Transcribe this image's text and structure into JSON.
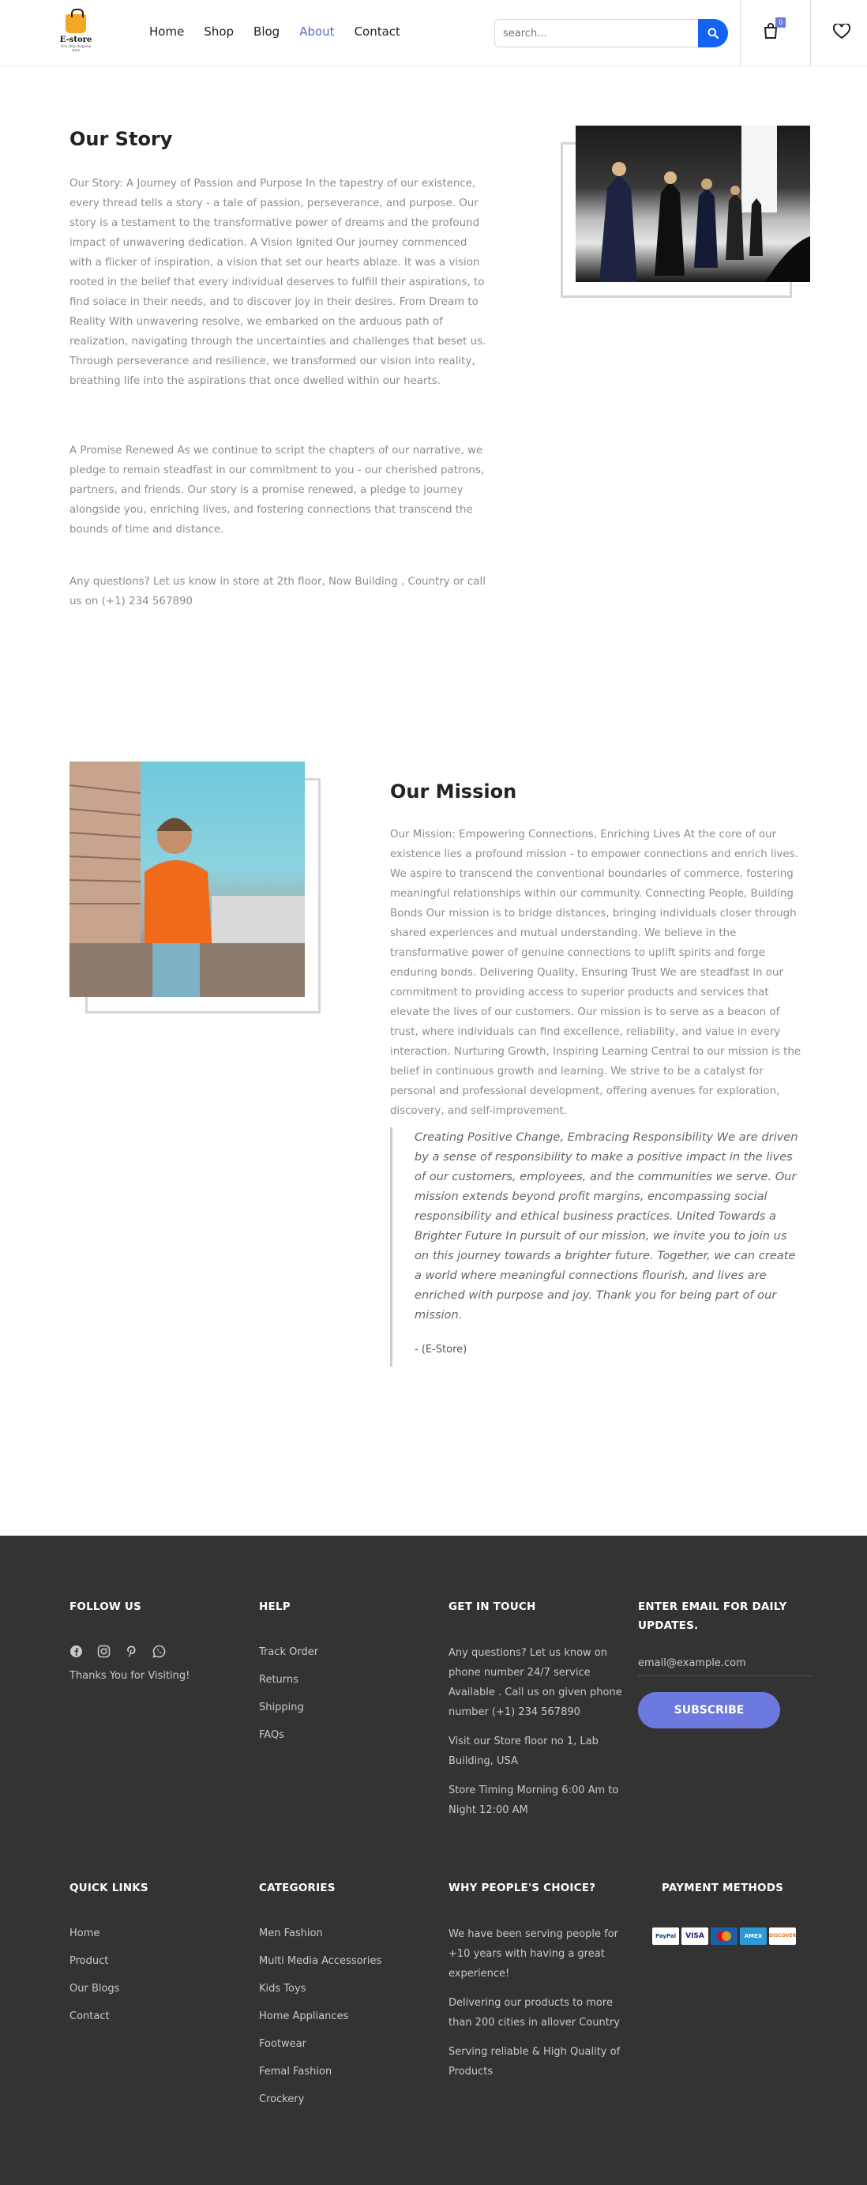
{
  "header": {
    "logo": {
      "name": "E-store",
      "tagline": "One stop shopping store"
    },
    "nav": [
      "Home",
      "Shop",
      "Blog",
      "About",
      "Contact"
    ],
    "active_nav": "About",
    "search_placeholder": "search...",
    "cart_count": "0",
    "accent": "#5c6ac4",
    "search_button_color": "#1463f3"
  },
  "story": {
    "title": "Our Story",
    "p1": "Our Story: A Journey of Passion and Purpose In the tapestry of our existence, every thread tells a story - a tale of passion, perseverance, and purpose. Our story is a testament to the transformative power of dreams and the profound impact of unwavering dedication. A Vision Ignited Our journey commenced with a flicker of inspiration, a vision that set our hearts ablaze. It was a vision rooted in the belief that every individual deserves to fulfill their aspirations, to find solace in their needs, and to discover joy in their desires. From Dream to Reality With unwavering resolve, we embarked on the arduous path of realization, navigating through the uncertainties and challenges that beset us. Through perseverance and resilience, we transformed our vision into reality, breathing life into the aspirations that once dwelled within our hearts.",
    "p2": "A Promise Renewed As we continue to script the chapters of our narrative, we pledge to remain steadfast in our commitment to you - our cherished patrons, partners, and friends. Our story is a promise renewed, a pledge to journey alongside you, enriching lives, and fostering connections that transcend the bounds of time and distance.",
    "p3": "Any questions? Let us know in store at 2th floor, Now Building , Country or call us on (+1) 234 567890"
  },
  "mission": {
    "title": "Our Mission",
    "p": "Our Mission: Empowering Connections, Enriching Lives At the core of our existence lies a profound mission - to empower connections and enrich lives. We aspire to transcend the conventional boundaries of commerce, fostering meaningful relationships within our community. Connecting People, Building Bonds Our mission is to bridge distances, bringing individuals closer through shared experiences and mutual understanding. We believe in the transformative power of genuine connections to uplift spirits and forge enduring bonds. Delivering Quality, Ensuring Trust We are steadfast in our commitment to providing access to superior products and services that elevate the lives of our customers. Our mission is to serve as a beacon of trust, where individuals can find excellence, reliability, and value in every interaction. Nurturing Growth, Inspiring Learning Central to our mission is the belief in continuous growth and learning. We strive to be a catalyst for personal and professional development, offering avenues for exploration, discovery, and self-improvement.",
    "quote": "Creating Positive Change, Embracing Responsibility We are driven by a sense of responsibility to make a positive impact in the lives of our customers, employees, and the communities we serve. Our mission extends beyond profit margins, encompassing social responsibility and ethical business practices. United Towards a Brighter Future In pursuit of our mission, we invite you to join us on this journey towards a brighter future. Together, we can create a world where meaningful connections flourish, and lives are enriched with purpose and joy. Thank you for being part of our mission.",
    "author": "- (E-Store)"
  },
  "footer": {
    "follow": {
      "title": "FOLLOW US",
      "icons": [
        "facebook-icon",
        "instagram-icon",
        "pinterest-icon",
        "whatsapp-icon"
      ],
      "thanks": "Thanks You for Visiting!"
    },
    "help": {
      "title": "HELP",
      "links": [
        "Track Order",
        "Returns",
        "Shipping",
        "FAQs"
      ]
    },
    "contact": {
      "title": "GET IN TOUCH",
      "phone": "Any questions? Let us know on phone number 24/7 service Available . Call us on given phone number (+1) 234 567890",
      "address": "Visit our Store floor no 1, Lab Building, USA",
      "timing": "Store Timing Morning 6:00 Am to Night 12:00 AM"
    },
    "newsletter": {
      "title": "ENTER EMAIL FOR DAILY UPDATES.",
      "placeholder": "email@example.com",
      "button": "SUBSCRIBE"
    },
    "quick_links": {
      "title": "QUICK LINKS",
      "links": [
        "Home",
        "Product",
        "Our Blogs",
        "Contact"
      ]
    },
    "categories": {
      "title": "CATEGORIES",
      "links": [
        "Men Fashion",
        "Multi Media Accessories",
        "Kids Toys",
        "Home Appliances",
        "Footwear",
        "Femal Fashion",
        "Crockery"
      ]
    },
    "why": {
      "title": "WHY PEOPLE'S CHOICE?",
      "points": [
        "We have been serving people for +10 years with having a great experience!",
        "Delivering our products to more than 200 cities in allover Country",
        "Serving reliable & High Quality of Products"
      ]
    },
    "payment": {
      "title": "PAYMENT METHODS",
      "methods": [
        "PayPal",
        "VISA",
        "MasterCard",
        "AMEX",
        "DISCOVER"
      ]
    }
  }
}
